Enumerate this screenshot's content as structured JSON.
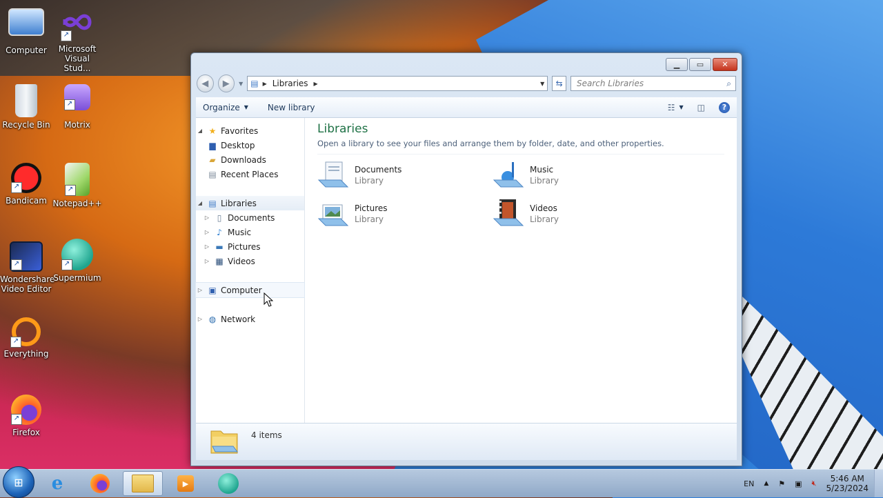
{
  "desktop": {
    "icons": [
      {
        "label": "Computer"
      },
      {
        "label": "Microsoft Visual Stud..."
      },
      {
        "label": "Recycle Bin"
      },
      {
        "label": "Motrix"
      },
      {
        "label": "Bandicam"
      },
      {
        "label": "Notepad++"
      },
      {
        "label": "Wondershare Video Editor"
      },
      {
        "label": "Supermium"
      },
      {
        "label": "Everything"
      },
      {
        "label": "Firefox"
      }
    ]
  },
  "window": {
    "address": {
      "crumb": "Libraries"
    },
    "search": {
      "placeholder": "Search Libraries"
    },
    "toolbar": {
      "organize": "Organize",
      "new_library": "New library",
      "help_glyph": "?"
    },
    "nav": {
      "favorites": "Favorites",
      "favorites_items": [
        "Desktop",
        "Downloads",
        "Recent Places"
      ],
      "libraries": "Libraries",
      "libraries_items": [
        "Documents",
        "Music",
        "Pictures",
        "Videos"
      ],
      "computer": "Computer",
      "network": "Network"
    },
    "content": {
      "title": "Libraries",
      "subtitle": "Open a library to see your files and arrange them by folder, date, and other properties.",
      "libraries": [
        {
          "name": "Documents",
          "type": "Library"
        },
        {
          "name": "Music",
          "type": "Library"
        },
        {
          "name": "Pictures",
          "type": "Library"
        },
        {
          "name": "Videos",
          "type": "Library"
        }
      ]
    },
    "details": {
      "count": "4 items"
    }
  },
  "taskbar": {
    "tray": {
      "language": "EN",
      "time": "5:46 AM",
      "date": "5/23/2024"
    }
  }
}
